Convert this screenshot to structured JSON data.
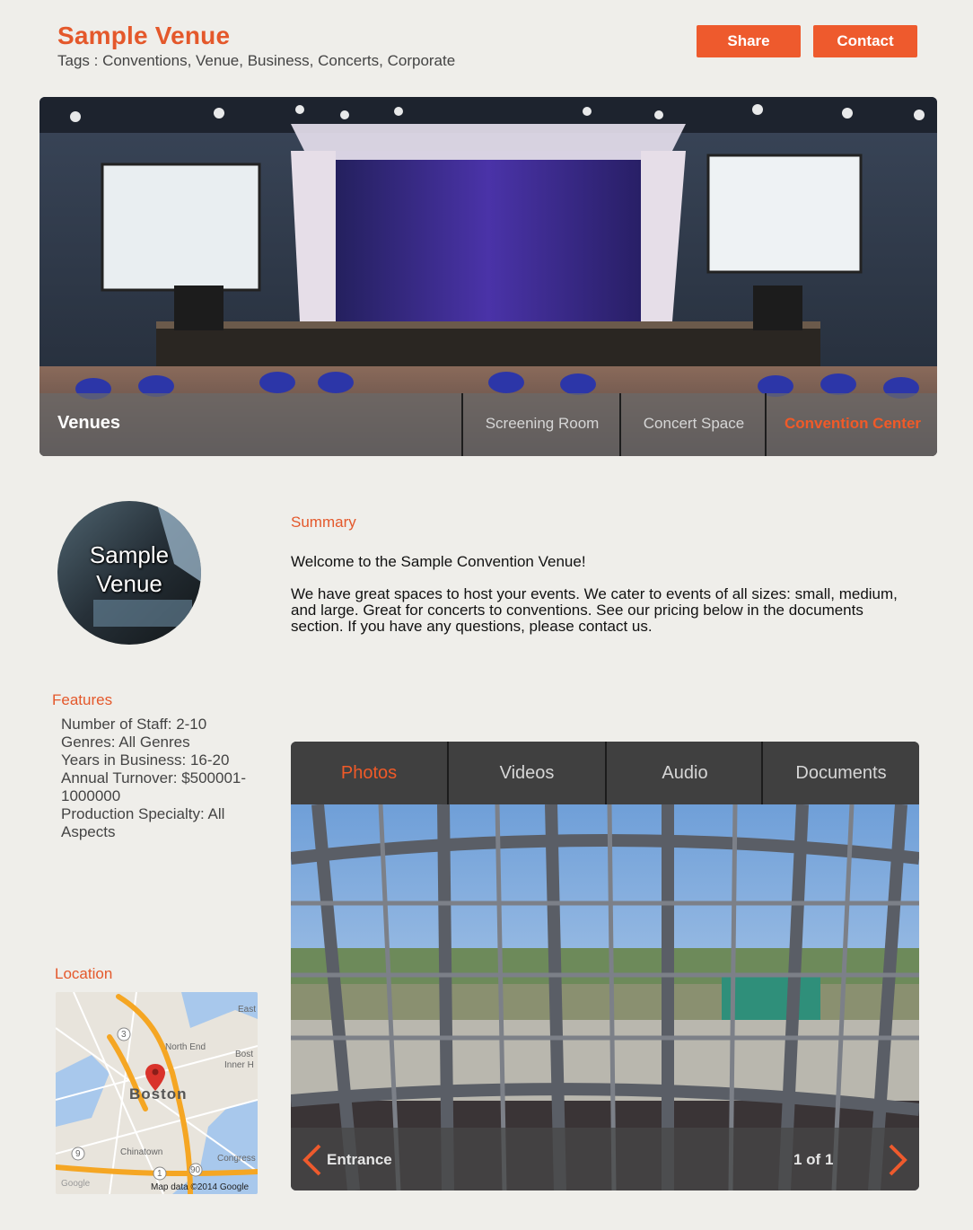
{
  "header": {
    "title": "Sample Venue",
    "tags": "Tags : Conventions, Venue, Business, Concerts, Corporate",
    "share_label": "Share",
    "contact_label": "Contact"
  },
  "hero": {
    "section_label": "Venues",
    "tabs": [
      {
        "label": "Screening Room",
        "active": false
      },
      {
        "label": "Concert Space",
        "active": false
      },
      {
        "label": "Convention Center",
        "active": true
      }
    ]
  },
  "logo": {
    "line1": "Sample",
    "line2": "Venue"
  },
  "summary": {
    "heading": "Summary",
    "intro": "Welcome to the Sample Convention Venue!",
    "body": "We have great spaces to host your events.  We cater to events of all sizes: small, medium, and large. Great for concerts to conventions.  See our pricing below in the documents section.  If you have any questions, please contact us."
  },
  "features": {
    "heading": "Features",
    "items": [
      "Number of Staff: 2-10",
      "Genres: All Genres",
      "Years in Business: 16-20",
      "Annual Turnover: $500001-1000000",
      "Production Specialty: All Aspects"
    ]
  },
  "location": {
    "heading": "Location",
    "map_city": "Boston",
    "map_attribution": "Map data ©2014 Google",
    "map_labels": [
      "East",
      "North End",
      "Bost",
      "Inner H",
      "Chinatown",
      "Congress",
      "Google"
    ],
    "route_numbers": [
      "3",
      "1",
      "9",
      "90"
    ]
  },
  "media": {
    "tabs": [
      {
        "label": "Photos",
        "active": true
      },
      {
        "label": "Videos",
        "active": false
      },
      {
        "label": "Audio",
        "active": false
      },
      {
        "label": "Documents",
        "active": false
      }
    ],
    "caption": "Entrance",
    "counter": "1 of 1"
  },
  "colors": {
    "accent": "#ee5a2d",
    "background": "#efeeea",
    "tab_bar": "#404040"
  }
}
